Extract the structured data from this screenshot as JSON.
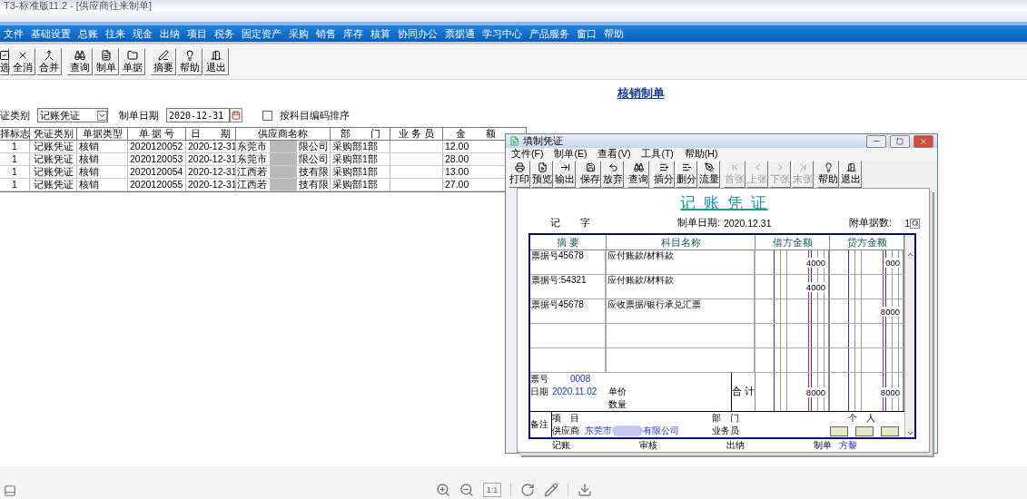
{
  "window": {
    "title": "T3-标准版11.2 - [供应商往来制单]"
  },
  "menu": [
    "文件",
    "基础设置",
    "总账",
    "往来",
    "现金",
    "出纳",
    "项目",
    "税务",
    "固定资产",
    "采购",
    "销售",
    "库存",
    "核算",
    "协同办公",
    "票据通",
    "学习中心",
    "产品服务",
    "窗口",
    "帮助"
  ],
  "toolbar": [
    [
      {
        "label": "选"
      },
      {
        "label": "全消"
      },
      {
        "label": "合并"
      }
    ],
    [
      {
        "label": "查询"
      },
      {
        "label": "制单"
      },
      {
        "label": "单据"
      }
    ],
    [
      {
        "label": "摘要"
      },
      {
        "label": "帮助"
      },
      {
        "label": "退出"
      }
    ]
  ],
  "heading": "核销制单",
  "filters": {
    "voucher_type_label": "证类别",
    "voucher_type": "记账凭证",
    "date_label": "制单日期",
    "date": "2020-12-31",
    "sort_by_code": {
      "label": "按科目编码排序",
      "checked": false
    }
  },
  "table": {
    "columns": [
      "择标志",
      "凭证类别",
      "单据类型",
      "单 据 号",
      "日　　期",
      "供应商名称",
      "部　　门",
      "业 务 员",
      "金　　额"
    ],
    "rows": [
      {
        "flag": "1",
        "voucher_type": "记账凭证",
        "doc_type": "核销",
        "doc_no": "2020120052",
        "date": "2020-12-31",
        "supplier_start": "东莞市",
        "supplier_end": "限公司",
        "department": "采购部1部",
        "amount": "12.00"
      },
      {
        "flag": "1",
        "voucher_type": "记账凭证",
        "doc_type": "核销",
        "doc_no": "2020120053",
        "date": "2020-12-31",
        "supplier_start": "东莞市",
        "supplier_end": "限公司",
        "department": "采购部1部",
        "amount": "28.00"
      },
      {
        "flag": "1",
        "voucher_type": "记账凭证",
        "doc_type": "核销",
        "doc_no": "2020120054",
        "date": "2020-12-31",
        "supplier_start": "江西若",
        "supplier_end": "技有限",
        "department": "采购部1部",
        "amount": "13.00"
      },
      {
        "flag": "1",
        "voucher_type": "记账凭证",
        "doc_type": "核销",
        "doc_no": "2020120055",
        "date": "2020-12-31",
        "supplier_start": "江西若",
        "supplier_end": "技有限",
        "department": "采购部1部",
        "amount": "27.00"
      }
    ]
  },
  "voucher": {
    "title": "填制凭证",
    "menu": [
      "文件(F)",
      "制单(E)",
      "查看(V)",
      "工具(T)",
      "帮助(H)"
    ],
    "toolbar": [
      [
        {
          "label": "打印",
          "disabled": false
        },
        {
          "label": "预览",
          "disabled": false
        },
        {
          "label": "输出",
          "disabled": false
        }
      ],
      [
        {
          "label": "保存",
          "disabled": false
        },
        {
          "label": "放弃",
          "disabled": false
        }
      ],
      [
        {
          "label": "查询",
          "disabled": false
        }
      ],
      [
        {
          "label": "插分",
          "disabled": false
        },
        {
          "label": "删分",
          "disabled": false
        },
        {
          "label": "流量",
          "disabled": false
        }
      ],
      [
        {
          "label": "首张",
          "disabled": true
        },
        {
          "label": "上张",
          "disabled": true
        },
        {
          "label": "下张",
          "disabled": true
        },
        {
          "label": "末张",
          "disabled": true
        }
      ],
      [
        {
          "label": "帮助",
          "disabled": false
        },
        {
          "label": "退出",
          "disabled": false
        }
      ]
    ],
    "heading": "记 账 凭 证",
    "type_label": "记",
    "type_suffix": "字",
    "date_label": "制单日期:",
    "date": "2020.12.31",
    "attachments_label": "附单据数:",
    "attachments": "1",
    "columns": [
      "摘 要",
      "科目名称",
      "借方金额",
      "贷方金额"
    ],
    "entries": [
      {
        "summary": "票据号45678",
        "account": "应付账款/材料款",
        "debit": "4000",
        "credit": "000"
      },
      {
        "summary": "票据号:54321",
        "account": "应付账款/材料款",
        "debit": "4000"
      },
      {
        "summary": "票据号45678",
        "account": "应收票据/银行承兑汇票",
        "credit": "8000"
      }
    ],
    "footer": {
      "ticket_label": "票号",
      "ticket": "0008",
      "date_label": "日期",
      "date": "2020.11.02",
      "price_label": "单价",
      "qty_label": "数量",
      "total_label": "合 计",
      "debit_total": "8000",
      "credit_total": "8000"
    },
    "remark": {
      "label": "备注",
      "project_label": "项　目",
      "department_label": "部　门",
      "person_label": "个　人",
      "supplier_label": "供应商",
      "supplier_start": "东莞市",
      "supplier_end": "有限公司",
      "salesperson_label": "业务员"
    },
    "signatures": [
      {
        "label": "记账"
      },
      {
        "label": "审核"
      },
      {
        "label": "出纳"
      },
      {
        "label": "制单",
        "value": "方黎"
      }
    ]
  },
  "viewer_bar": {
    "ratio": "1:1"
  }
}
